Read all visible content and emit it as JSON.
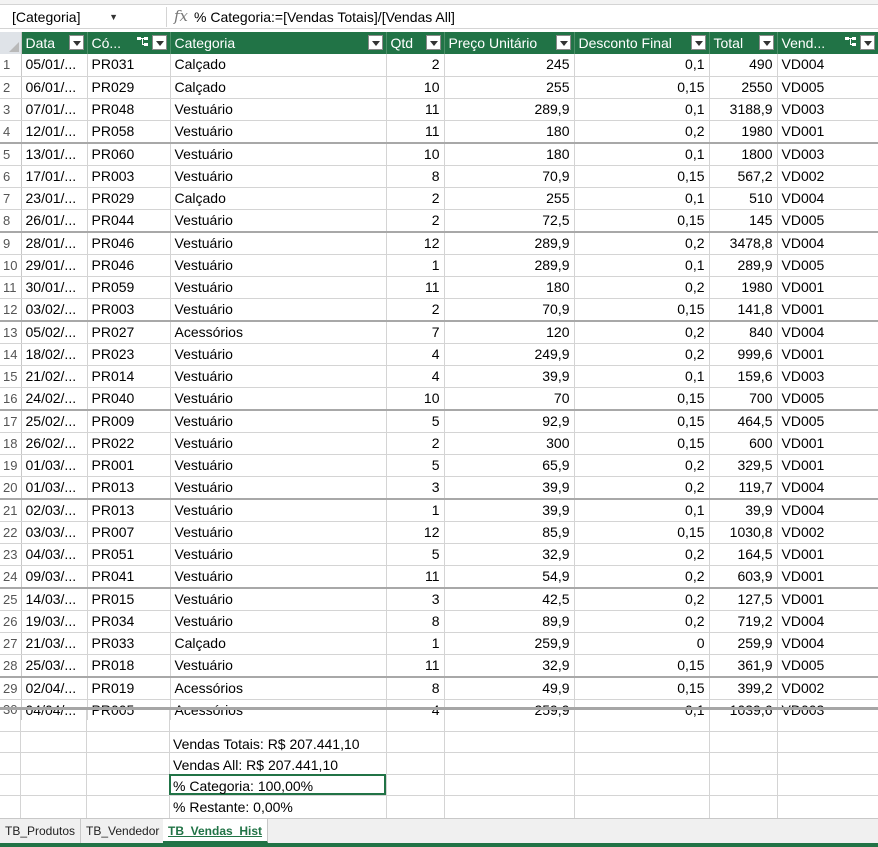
{
  "name_box": "[Categoria]",
  "fx_symbol": "fx",
  "formula": "% Categoria:=[Vendas Totais]/[Vendas All]",
  "columns": [
    "Data",
    "Có...",
    "Categoria",
    "Qtd",
    "Preço Unitário",
    "Desconto Final",
    "Total",
    "Vend..."
  ],
  "rows": [
    {
      "n": "1",
      "data": "05/01/...",
      "cod": "PR031",
      "cat": "Calçado",
      "qtd": "2",
      "preco": "245",
      "desc": "0,1",
      "total": "490",
      "vend": "VD004"
    },
    {
      "n": "2",
      "data": "06/01/...",
      "cod": "PR029",
      "cat": "Calçado",
      "qtd": "10",
      "preco": "255",
      "desc": "0,15",
      "total": "2550",
      "vend": "VD005"
    },
    {
      "n": "3",
      "data": "07/01/...",
      "cod": "PR048",
      "cat": "Vestuário",
      "qtd": "11",
      "preco": "289,9",
      "desc": "0,1",
      "total": "3188,9",
      "vend": "VD003"
    },
    {
      "n": "4",
      "data": "12/01/...",
      "cod": "PR058",
      "cat": "Vestuário",
      "qtd": "11",
      "preco": "180",
      "desc": "0,2",
      "total": "1980",
      "vend": "VD001"
    },
    {
      "n": "5",
      "data": "13/01/...",
      "cod": "PR060",
      "cat": "Vestuário",
      "qtd": "10",
      "preco": "180",
      "desc": "0,1",
      "total": "1800",
      "vend": "VD003"
    },
    {
      "n": "6",
      "data": "17/01/...",
      "cod": "PR003",
      "cat": "Vestuário",
      "qtd": "8",
      "preco": "70,9",
      "desc": "0,15",
      "total": "567,2",
      "vend": "VD002"
    },
    {
      "n": "7",
      "data": "23/01/...",
      "cod": "PR029",
      "cat": "Calçado",
      "qtd": "2",
      "preco": "255",
      "desc": "0,1",
      "total": "510",
      "vend": "VD004"
    },
    {
      "n": "8",
      "data": "26/01/...",
      "cod": "PR044",
      "cat": "Vestuário",
      "qtd": "2",
      "preco": "72,5",
      "desc": "0,15",
      "total": "145",
      "vend": "VD005"
    },
    {
      "n": "9",
      "data": "28/01/...",
      "cod": "PR046",
      "cat": "Vestuário",
      "qtd": "12",
      "preco": "289,9",
      "desc": "0,2",
      "total": "3478,8",
      "vend": "VD004"
    },
    {
      "n": "10",
      "data": "29/01/...",
      "cod": "PR046",
      "cat": "Vestuário",
      "qtd": "1",
      "preco": "289,9",
      "desc": "0,1",
      "total": "289,9",
      "vend": "VD005"
    },
    {
      "n": "11",
      "data": "30/01/...",
      "cod": "PR059",
      "cat": "Vestuário",
      "qtd": "11",
      "preco": "180",
      "desc": "0,2",
      "total": "1980",
      "vend": "VD001"
    },
    {
      "n": "12",
      "data": "03/02/...",
      "cod": "PR003",
      "cat": "Vestuário",
      "qtd": "2",
      "preco": "70,9",
      "desc": "0,15",
      "total": "141,8",
      "vend": "VD001"
    },
    {
      "n": "13",
      "data": "05/02/...",
      "cod": "PR027",
      "cat": "Acessórios",
      "qtd": "7",
      "preco": "120",
      "desc": "0,2",
      "total": "840",
      "vend": "VD004"
    },
    {
      "n": "14",
      "data": "18/02/...",
      "cod": "PR023",
      "cat": "Vestuário",
      "qtd": "4",
      "preco": "249,9",
      "desc": "0,2",
      "total": "999,6",
      "vend": "VD001"
    },
    {
      "n": "15",
      "data": "21/02/...",
      "cod": "PR014",
      "cat": "Vestuário",
      "qtd": "4",
      "preco": "39,9",
      "desc": "0,1",
      "total": "159,6",
      "vend": "VD003"
    },
    {
      "n": "16",
      "data": "24/02/...",
      "cod": "PR040",
      "cat": "Vestuário",
      "qtd": "10",
      "preco": "70",
      "desc": "0,15",
      "total": "700",
      "vend": "VD005"
    },
    {
      "n": "17",
      "data": "25/02/...",
      "cod": "PR009",
      "cat": "Vestuário",
      "qtd": "5",
      "preco": "92,9",
      "desc": "0,15",
      "total": "464,5",
      "vend": "VD005"
    },
    {
      "n": "18",
      "data": "26/02/...",
      "cod": "PR022",
      "cat": "Vestuário",
      "qtd": "2",
      "preco": "300",
      "desc": "0,15",
      "total": "600",
      "vend": "VD001"
    },
    {
      "n": "19",
      "data": "01/03/...",
      "cod": "PR001",
      "cat": "Vestuário",
      "qtd": "5",
      "preco": "65,9",
      "desc": "0,2",
      "total": "329,5",
      "vend": "VD001"
    },
    {
      "n": "20",
      "data": "01/03/...",
      "cod": "PR013",
      "cat": "Vestuário",
      "qtd": "3",
      "preco": "39,9",
      "desc": "0,2",
      "total": "119,7",
      "vend": "VD004"
    },
    {
      "n": "21",
      "data": "02/03/...",
      "cod": "PR013",
      "cat": "Vestuário",
      "qtd": "1",
      "preco": "39,9",
      "desc": "0,1",
      "total": "39,9",
      "vend": "VD004"
    },
    {
      "n": "22",
      "data": "03/03/...",
      "cod": "PR007",
      "cat": "Vestuário",
      "qtd": "12",
      "preco": "85,9",
      "desc": "0,15",
      "total": "1030,8",
      "vend": "VD002"
    },
    {
      "n": "23",
      "data": "04/03/...",
      "cod": "PR051",
      "cat": "Vestuário",
      "qtd": "5",
      "preco": "32,9",
      "desc": "0,2",
      "total": "164,5",
      "vend": "VD001"
    },
    {
      "n": "24",
      "data": "09/03/...",
      "cod": "PR041",
      "cat": "Vestuário",
      "qtd": "11",
      "preco": "54,9",
      "desc": "0,2",
      "total": "603,9",
      "vend": "VD001"
    },
    {
      "n": "25",
      "data": "14/03/...",
      "cod": "PR015",
      "cat": "Vestuário",
      "qtd": "3",
      "preco": "42,5",
      "desc": "0,2",
      "total": "127,5",
      "vend": "VD001"
    },
    {
      "n": "26",
      "data": "19/03/...",
      "cod": "PR034",
      "cat": "Vestuário",
      "qtd": "8",
      "preco": "89,9",
      "desc": "0,2",
      "total": "719,2",
      "vend": "VD004"
    },
    {
      "n": "27",
      "data": "21/03/...",
      "cod": "PR033",
      "cat": "Calçado",
      "qtd": "1",
      "preco": "259,9",
      "desc": "0",
      "total": "259,9",
      "vend": "VD004"
    },
    {
      "n": "28",
      "data": "25/03/...",
      "cod": "PR018",
      "cat": "Vestuário",
      "qtd": "11",
      "preco": "32,9",
      "desc": "0,15",
      "total": "361,9",
      "vend": "VD005"
    },
    {
      "n": "29",
      "data": "02/04/...",
      "cod": "PR019",
      "cat": "Acessórios",
      "qtd": "8",
      "preco": "49,9",
      "desc": "0,15",
      "total": "399,2",
      "vend": "VD002"
    },
    {
      "n": "30",
      "data": "04/04/...",
      "cod": "PR005",
      "cat": "Acessórios",
      "qtd": "4",
      "preco": "259,9",
      "desc": "0,1",
      "total": "1039,6",
      "vend": "VD003"
    }
  ],
  "measures": {
    "vendas_totais": "Vendas Totais: R$ 207.441,10",
    "vendas_all": "Vendas All: R$ 207.441,10",
    "pct_categoria": "% Categoria: 100,00%",
    "pct_restante": "% Restante: 0,00%"
  },
  "sheet_tabs": [
    "TB_Produtos",
    "TB_Vendedor",
    "TB_Vendas_Hist"
  ],
  "active_tab": "TB_Vendas_Hist",
  "colors": {
    "header_green": "#217346",
    "gridline": "#d4d4d4"
  }
}
